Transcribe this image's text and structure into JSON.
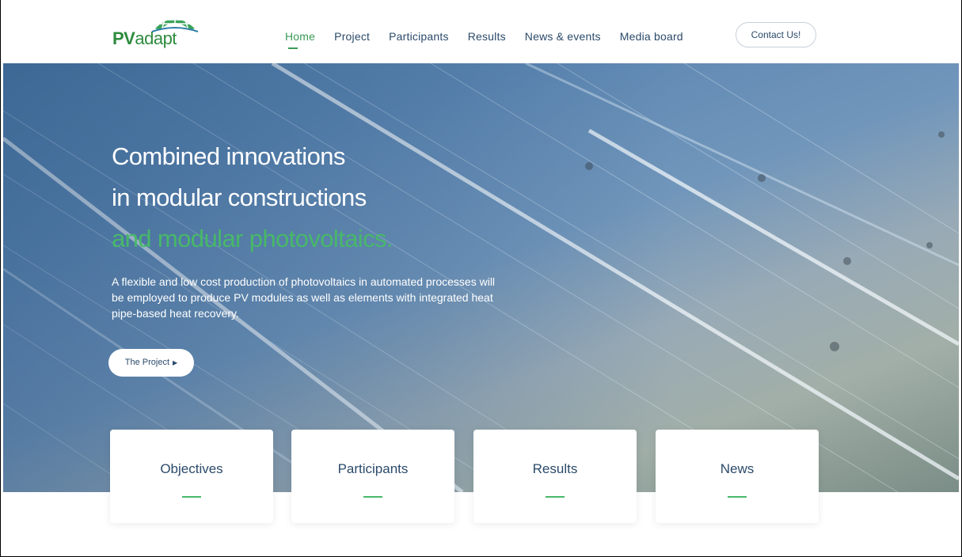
{
  "brand": {
    "pv": "PV",
    "adapt": "adapt"
  },
  "nav": {
    "items": [
      {
        "label": "Home",
        "active": true
      },
      {
        "label": "Project",
        "active": false
      },
      {
        "label": "Participants",
        "active": false
      },
      {
        "label": "Results",
        "active": false
      },
      {
        "label": "News & events",
        "active": false
      },
      {
        "label": "Media board",
        "active": false
      }
    ],
    "contact_label": "Contact Us!"
  },
  "hero": {
    "title_line1": "Combined innovations",
    "title_line2": "in modular constructions",
    "title_line3": "and modular photovoltaics.",
    "description": "A flexible and low cost production of photovoltaics in automated processes will be employed to produce PV modules as well as elements with integrated heat pipe-based heat recovery.",
    "button_label": "The Project"
  },
  "cards": [
    {
      "title": "Objectives"
    },
    {
      "title": "Participants"
    },
    {
      "title": "Results"
    },
    {
      "title": "News"
    }
  ],
  "colors": {
    "accent_green": "#47b869",
    "text_navy": "#2b4a6a",
    "active_nav": "#3a9a56"
  }
}
